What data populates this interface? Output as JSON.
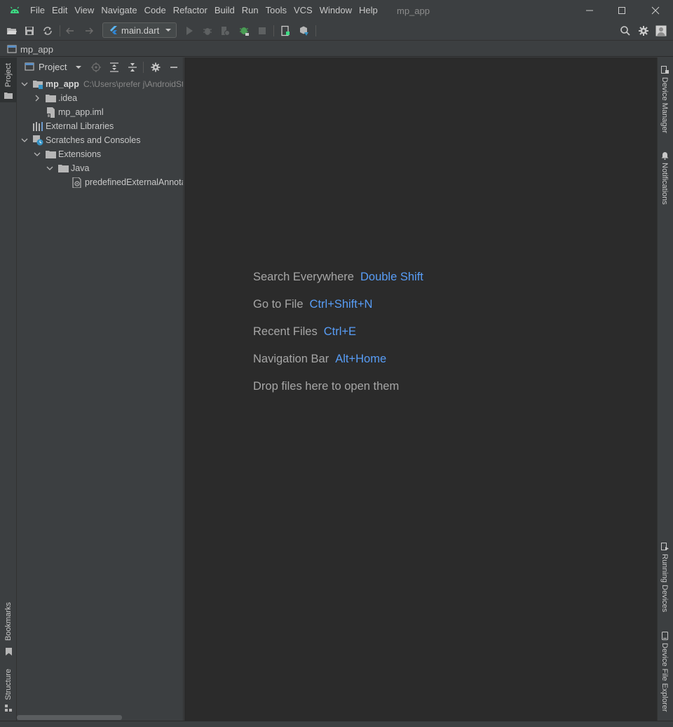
{
  "window": {
    "title": "mp_app",
    "menu": [
      {
        "label": "File"
      },
      {
        "label": "Edit"
      },
      {
        "label": "View"
      },
      {
        "label": "Navigate"
      },
      {
        "label": "Code"
      },
      {
        "label": "Refactor"
      },
      {
        "label": "Build"
      },
      {
        "label": "Run"
      },
      {
        "label": "Tools"
      },
      {
        "label": "VCS"
      },
      {
        "label": "Window"
      },
      {
        "label": "Help"
      }
    ]
  },
  "toolbar": {
    "run_config": "main.dart"
  },
  "navbar": {
    "project": "mp_app"
  },
  "left_strip": {
    "project": "Project",
    "bookmarks": "Bookmarks",
    "structure": "Structure"
  },
  "project_panel": {
    "title": "Project",
    "tree": [
      {
        "label": "mp_app",
        "path": "C:\\Users\\prefer j\\AndroidStudioProjects\\mp_app"
      },
      {
        "label": ".idea"
      },
      {
        "label": "mp_app.iml"
      },
      {
        "label": "External Libraries"
      },
      {
        "label": "Scratches and Consoles"
      },
      {
        "label": "Extensions"
      },
      {
        "label": "Java"
      },
      {
        "label": "predefinedExternalAnnotations.json"
      }
    ]
  },
  "editor": {
    "hints": [
      {
        "label": "Search Everywhere",
        "key": "Double Shift"
      },
      {
        "label": "Go to File",
        "key": "Ctrl+Shift+N"
      },
      {
        "label": "Recent Files",
        "key": "Ctrl+E"
      },
      {
        "label": "Navigation Bar",
        "key": "Alt+Home"
      },
      {
        "label": "Drop files here to open them",
        "key": ""
      }
    ]
  },
  "right_strip": {
    "device_manager": "Device Manager",
    "notifications": "Notifications",
    "running_devices": "Running Devices",
    "device_file_explorer": "Device File Explorer"
  },
  "colors": {
    "accent_key": "#589df6",
    "editor_bg": "#2b2b2b",
    "panel_bg": "#3c3f41",
    "android_green": "#3ddc84"
  }
}
